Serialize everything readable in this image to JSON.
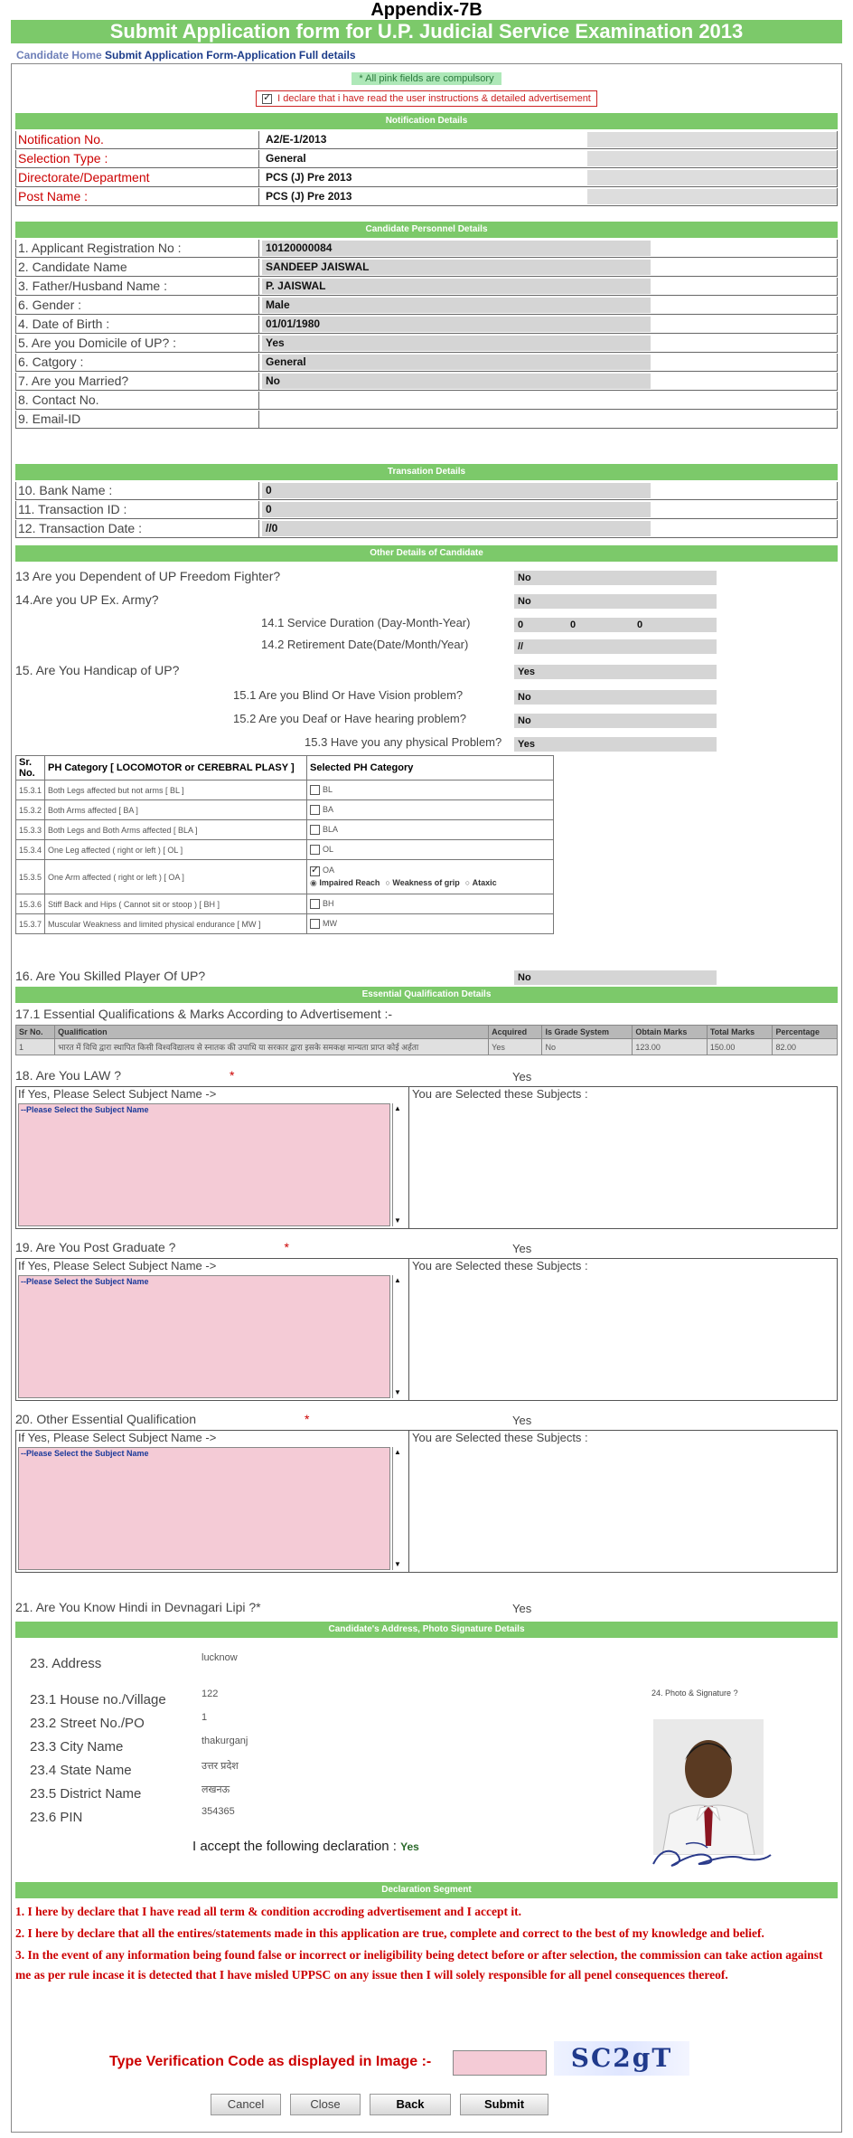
{
  "header": {
    "appendix": "Appendix-7B",
    "banner": "Submit Application form for U.P. Judicial Service Examination 2013",
    "breadcrumb_home": "Candidate Home",
    "breadcrumb_path": "Submit Application Form-Application Full details"
  },
  "notices": {
    "pink_fields": "* All pink fields are compulsory",
    "declaration_check": "I declare that i have read the user instructions & detailed advertisement"
  },
  "notification": {
    "heading": "Notification Details",
    "rows": [
      {
        "label": "Notification No.",
        "value": "A2/E-1/2013"
      },
      {
        "label": "Selection Type :",
        "value": "General"
      },
      {
        "label": "Directorate/Department",
        "value": "PCS (J) Pre 2013"
      },
      {
        "label": "Post Name :",
        "value": "PCS (J) Pre 2013"
      }
    ]
  },
  "personnel": {
    "heading": "Candidate Personnel Details",
    "rows": [
      {
        "label": "1. Applicant Registration No :",
        "value": "10120000084"
      },
      {
        "label": "2. Candidate Name",
        "value": "SANDEEP JAISWAL"
      },
      {
        "label": "3. Father/Husband Name :",
        "value": "P. JAISWAL"
      },
      {
        "label": "6. Gender :",
        "value": "Male"
      },
      {
        "label": "4. Date of Birth :",
        "value": "01/01/1980"
      },
      {
        "label": "5. Are you Domicile of UP? :",
        "value": "Yes"
      },
      {
        "label": "6. Catgory :",
        "value": "General"
      },
      {
        "label": "7. Are you Married?",
        "value": "No"
      },
      {
        "label": "8. Contact No.",
        "value": ""
      },
      {
        "label": "9. Email-ID",
        "value": ""
      }
    ]
  },
  "transaction": {
    "heading": "Transation Details",
    "rows": [
      {
        "label": "10. Bank Name :",
        "value": "0"
      },
      {
        "label": "11. Transaction ID :",
        "value": "0"
      },
      {
        "label": "12. Transaction Date :",
        "value": "//0"
      }
    ]
  },
  "other": {
    "heading": "Other Details of Candidate",
    "q13": "13 Are you Dependent of UP Freedom Fighter?",
    "q13_val": "No",
    "q14": "14.Are you UP Ex. Army?",
    "q14_val": "No",
    "q141": "14.1 Service Duration (Day-Month-Year)",
    "q141_val": "0",
    "q141_val2": "0",
    "q141_val3": "0",
    "q142": "14.2 Retirement Date(Date/Month/Year)",
    "q142_val": "//",
    "q15": "15. Are You Handicap of UP?",
    "q15_val": "Yes",
    "q151": "15.1 Are you Blind Or Have Vision problem?",
    "q151_val": "No",
    "q152": "15.2 Are you Deaf or Have hearing problem?",
    "q152_val": "No",
    "q153": "15.3 Have you any physical Problem?",
    "q153_val": "Yes"
  },
  "ph_table": {
    "col1": "Sr. No.",
    "col2": "PH Category [ LOCOMOTOR or CEREBRAL PLASY ]",
    "col3": "Selected PH Category",
    "rows": [
      {
        "sr": "15.3.1",
        "cat": "Both Legs affected but not arms [ BL ]",
        "sel": "BL"
      },
      {
        "sr": "15.3.2",
        "cat": "Both Arms affected [ BA ]",
        "sel": "BA"
      },
      {
        "sr": "15.3.3",
        "cat": "Both Legs and Both Arms affected [ BLA ]",
        "sel": "BLA"
      },
      {
        "sr": "15.3.4",
        "cat": "One Leg affected ( right or left ) [ OL ]",
        "sel": "OL"
      },
      {
        "sr": "15.3.5",
        "cat": "One Arm affected ( right or left ) [ OA ]",
        "sel": "OA"
      },
      {
        "sr": "15.3.6",
        "cat": "Stiff Back and Hips ( Cannot sit or stoop ) [ BH ]",
        "sel": "BH"
      },
      {
        "sr": "15.3.7",
        "cat": "Muscular Weakness and limited physical endurance [ MW ]",
        "sel": "MW"
      }
    ],
    "oa_options": [
      "Impaired Reach",
      "Weakness of grip",
      "Ataxic"
    ]
  },
  "q16": {
    "label": "16. Are You Skilled Player Of UP?",
    "value": "No"
  },
  "essential": {
    "heading": "Essential Qualification Details",
    "title": "17.1 Essential Qualifications & Marks According to Advertisement :-",
    "headers": [
      "Sr No.",
      "Qualification",
      "Acquired",
      "Is Grade System",
      "Obtain Marks",
      "Total Marks",
      "Percentage"
    ],
    "row": [
      "1",
      "भारत में विधि द्वारा स्थापित किसी विश्वविद्यालय से स्नातक की उपाधि या सरकार द्वारा इसके समकक्ष मान्यता प्राप्त कोई अर्हता",
      "Yes",
      "No",
      "123.00",
      "150.00",
      "82.00"
    ]
  },
  "subjects": [
    {
      "question": "18. Are You LAW ?",
      "answer": "Yes",
      "prompt": "If Yes, Please Select Subject Name ->",
      "selected_caption": "You are Selected these Subjects :",
      "option": "--Please Select the Subject Name"
    },
    {
      "question": "19. Are You Post Graduate ?",
      "answer": "Yes",
      "prompt": "If Yes, Please Select Subject Name ->",
      "selected_caption": "You are Selected these Subjects :",
      "option": "--Please Select the Subject Name"
    },
    {
      "question": "20. Other Essential Qualification",
      "answer": "Yes",
      "prompt": "If Yes, Please Select Subject Name ->",
      "selected_caption": "You are Selected these Subjects :",
      "option": "--Please Select the Subject Name"
    }
  ],
  "q21": {
    "label": "21. Are You Know Hindi in Devnagari Lipi ?*",
    "value": "Yes"
  },
  "address": {
    "heading": "Candidate's Address, Photo Signature Details",
    "photo_label": "24. Photo & Signature ?",
    "rows": [
      {
        "label": "23. Address",
        "value": "lucknow"
      },
      {
        "label": "23.1 House no./Village",
        "value": "122"
      },
      {
        "label": "23.2 Street No./PO",
        "value": "1"
      },
      {
        "label": "23.3 City Name",
        "value": "thakurganj"
      },
      {
        "label": "23.4 State Name",
        "value": "उत्तर प्रदेश"
      },
      {
        "label": "23.5 District Name",
        "value": "लखनऊ"
      },
      {
        "label": "23.6 PIN",
        "value": "354365"
      }
    ],
    "accept": "I accept the following declaration :",
    "accept_val": "Yes"
  },
  "declaration": {
    "heading": "Declaration Segment",
    "items": [
      "1. I here by declare that I have read all term & condition accroding advertisement and I accept it.",
      "2. I here by declare that all the entires/statements made in this application are true, complete and correct to the best of my knowledge and belief.",
      "3. In the event of any information being found false or incorrect or ineligibility being detect before or after selection, the commission can take action against me as per rule incase it is detected that I have misled UPPSC on any issue then I will solely responsible for all penel consequences thereof."
    ]
  },
  "verification": {
    "label": "Type Verification Code as displayed in Image :-",
    "captcha": "SC2gT",
    "input_value": ""
  },
  "buttons": {
    "cancel": "Cancel",
    "close": "Close",
    "back": "Back",
    "submit": "Submit"
  },
  "colors": {
    "section_green": "#7cc96a",
    "required_red": "#cc0000",
    "pink_field": "#f4cbd6"
  }
}
